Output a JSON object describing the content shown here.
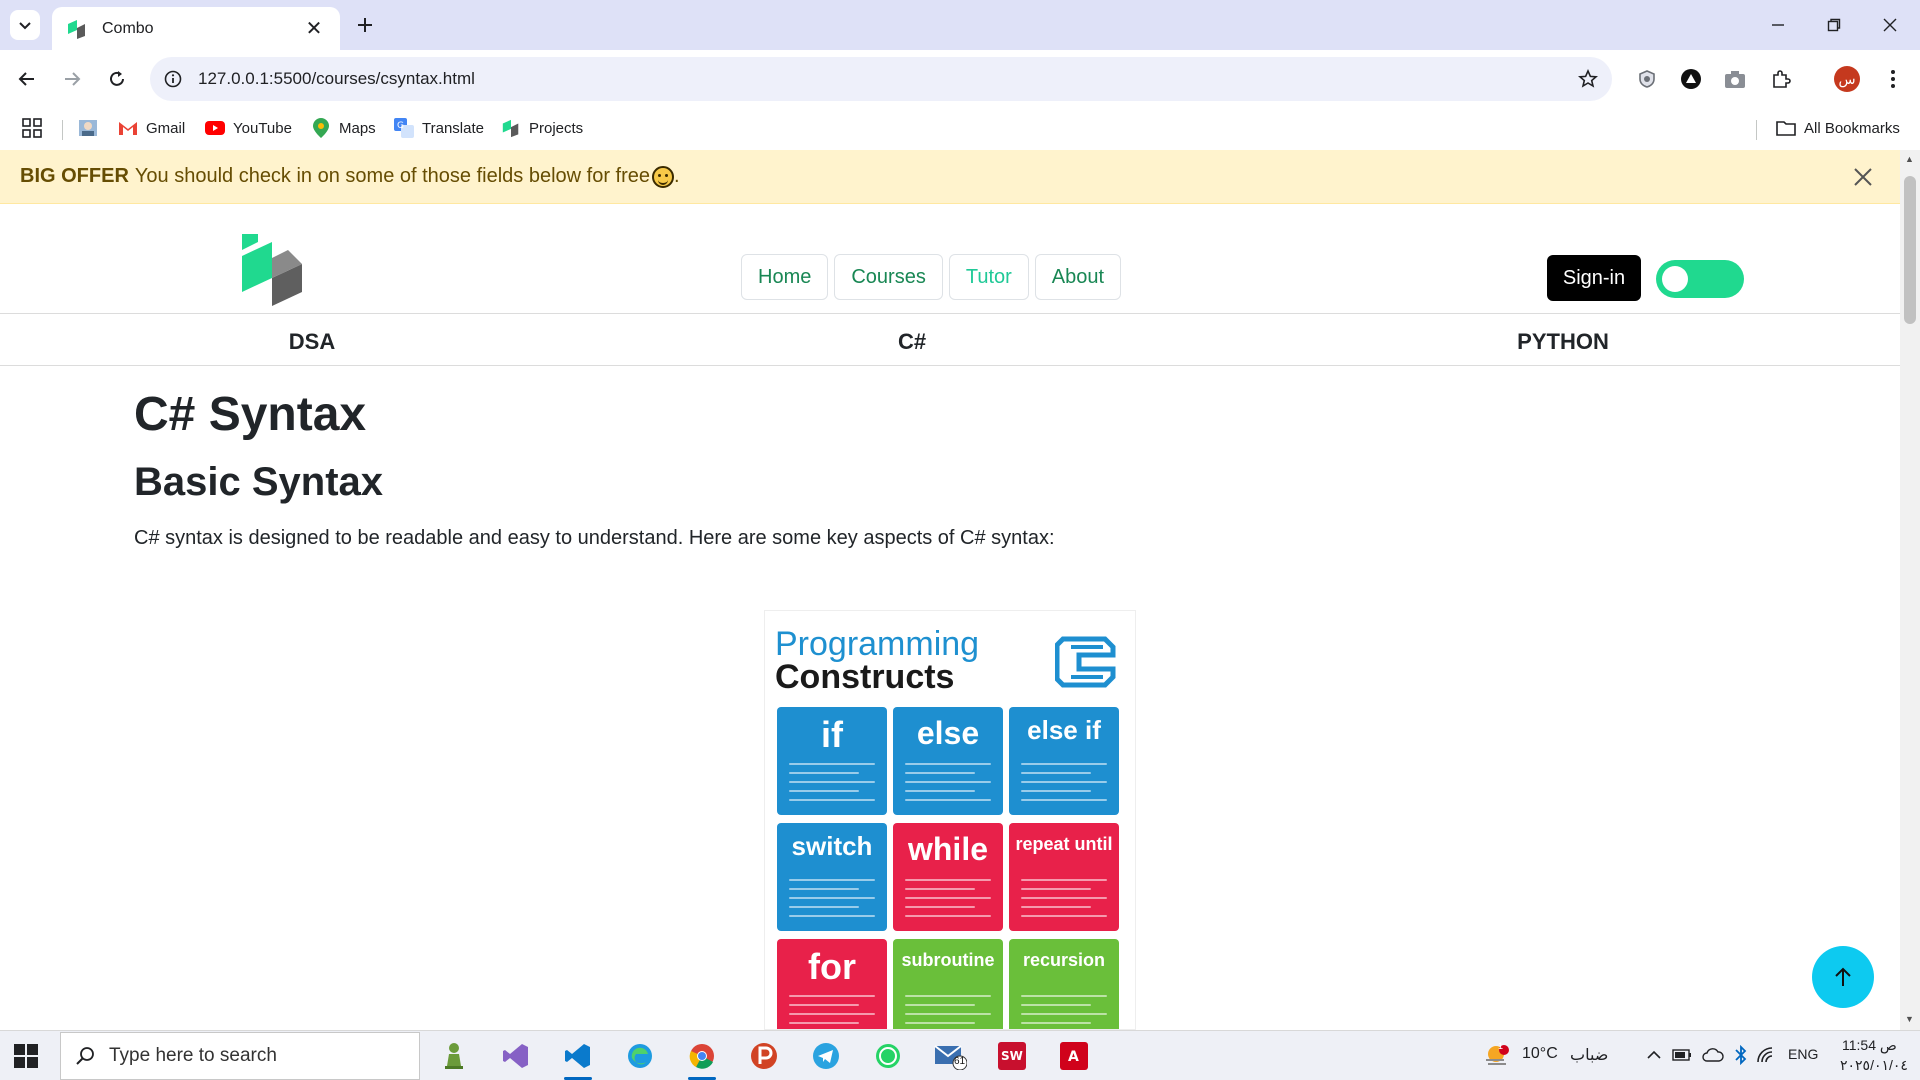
{
  "browser": {
    "tab_title": "Combo",
    "url": "127.0.0.1:5500/courses/csyntax.html",
    "bookmarks": [
      "Gmail",
      "YouTube",
      "Maps",
      "Translate",
      "Projects"
    ],
    "all_bookmarks": "All Bookmarks",
    "profile_initial": "س"
  },
  "alert": {
    "strong": "BIG OFFER",
    "text": "You should check in on some of those fields below for free",
    "period": "."
  },
  "navbar": {
    "links": [
      "Home",
      "Courses",
      "Tutor",
      "About"
    ],
    "active": "Tutor",
    "signin": "Sign-in"
  },
  "subnav": [
    "DSA",
    "C#",
    "PYTHON"
  ],
  "content": {
    "title": "C# Syntax",
    "subtitle": "Basic Syntax",
    "paragraph": "C# syntax is designed to be readable and easy to understand. Here are some key aspects of C# syntax:"
  },
  "poster": {
    "title_line1": "Programming",
    "title_line2": "Constructs",
    "tiles": [
      {
        "label": "if",
        "color": "#1e8fd0"
      },
      {
        "label": "else",
        "color": "#1e8fd0"
      },
      {
        "label": "else if",
        "color": "#1e8fd0"
      },
      {
        "label": "switch",
        "color": "#1e8fd0"
      },
      {
        "label": "while",
        "color": "#e8214a"
      },
      {
        "label": "repeat until",
        "color": "#e8214a"
      },
      {
        "label": "for",
        "color": "#e8214a"
      },
      {
        "label": "subroutine",
        "color": "#6abf3a"
      },
      {
        "label": "recursion",
        "color": "#6abf3a"
      }
    ]
  },
  "taskbar": {
    "search_placeholder": "Type here to search",
    "weather": "10°C",
    "weather_desc": "ضباب",
    "language": "ENG",
    "time": "11:54 ص",
    "date": "٢٠٢٥/٠١/٠٤",
    "weather_badge": "1",
    "mail_badge": "61"
  },
  "colors": {
    "accent_green": "#20d98f",
    "link_green": "#198754",
    "alert_bg": "#fff3cd",
    "totop": "#0dcaf0"
  }
}
